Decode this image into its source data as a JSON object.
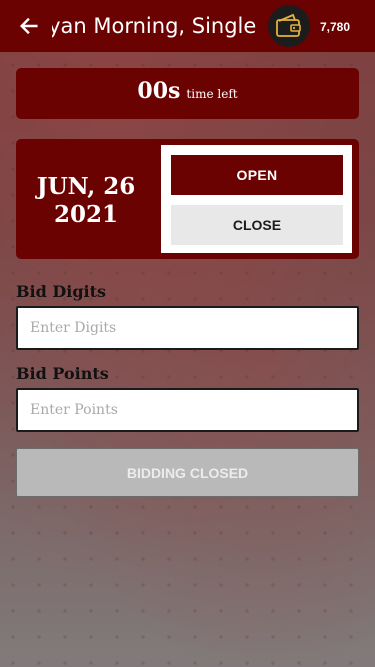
{
  "header": {
    "back_icon": "arrow-left-icon",
    "title": "Kalyan Morning, Single Digit",
    "wallet_icon": "wallet-icon",
    "balance": "7,780"
  },
  "timer": {
    "value": "00s",
    "caption": "time left"
  },
  "date_card": {
    "date_line1": "JUN, 26",
    "date_line2": "2021",
    "open_label": "OPEN",
    "close_label": "CLOSE"
  },
  "form": {
    "digits_label": "Bid Digits",
    "digits_placeholder": "Enter Digits",
    "points_label": "Bid Points",
    "points_placeholder": "Enter Points",
    "submit_label": "BIDDING CLOSED"
  },
  "colors": {
    "brand": "#6b0202",
    "accent_gold": "#e2b23a",
    "disabled": "#b9b9b9"
  }
}
